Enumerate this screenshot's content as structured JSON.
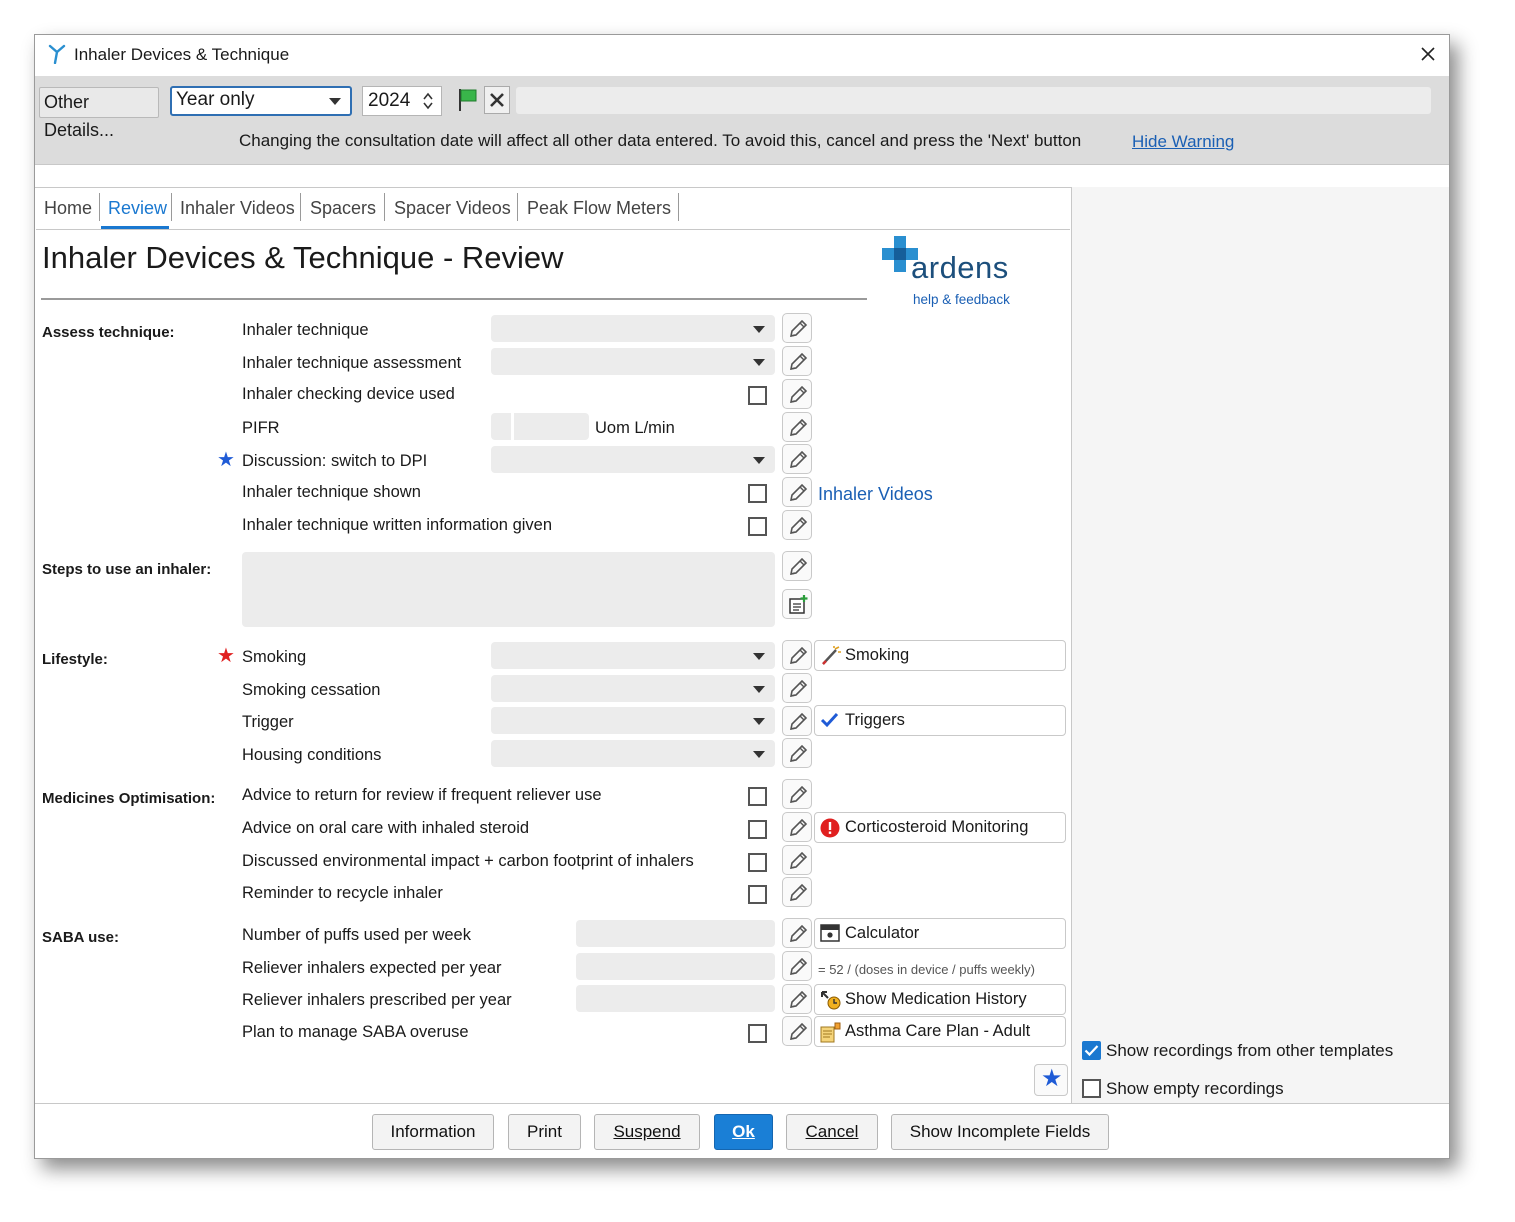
{
  "window": {
    "title": "Inhaler Devices & Technique"
  },
  "toolbar": {
    "other_details": "Other Details...",
    "date_mode": "Year only",
    "year": "2024",
    "warning": "Changing the consultation date will affect all other data entered. To avoid this, cancel and press the 'Next' button",
    "hide_warning": "Hide Warning"
  },
  "tabs": [
    "Home",
    "Review",
    "Inhaler Videos",
    "Spacers",
    "Spacer Videos",
    "Peak Flow Meters"
  ],
  "page_title": "Inhaler Devices & Technique - Review",
  "logo": {
    "text": "ardens",
    "sub": "help & feedback"
  },
  "sections": {
    "assess": "Assess technique:",
    "steps": "Steps to use an inhaler:",
    "lifestyle": "Lifestyle:",
    "medicines": "Medicines Optimisation:",
    "saba": "SABA use:"
  },
  "assess_rows": [
    "Inhaler technique",
    "Inhaler technique assessment",
    "Inhaler checking device used",
    "PIFR",
    "Discussion: switch to DPI",
    "Inhaler technique shown",
    "Inhaler technique written information given"
  ],
  "pifr_uom": "Uom L/min",
  "inhaler_videos_link": "Inhaler Videos",
  "lifestyle_rows": [
    "Smoking",
    "Smoking cessation",
    "Trigger",
    "Housing conditions"
  ],
  "medicines_rows": [
    "Advice to return for review if frequent reliever use",
    "Advice on oral care with inhaled steroid",
    "Discussed environmental impact + carbon footprint of inhalers",
    "Reminder to recycle inhaler"
  ],
  "saba_rows": [
    "Number of puffs used per week",
    "Reliever inhalers expected per year",
    "Reliever inhalers prescribed per year",
    "Plan to manage SABA overuse"
  ],
  "side_buttons": {
    "smoking": "Smoking",
    "triggers": "Triggers",
    "corticosteroid": "Corticosteroid Monitoring",
    "calculator": "Calculator",
    "formula": "= 52 / (doses in device / puffs weekly)",
    "med_history": "Show Medication History",
    "care_plan": "Asthma Care Plan - Adult"
  },
  "options": {
    "show_other": "Show recordings from other templates",
    "show_other_checked": true,
    "show_empty": "Show empty recordings",
    "show_empty_checked": false
  },
  "footer": [
    "Information",
    "Print",
    "Suspend",
    "Ok",
    "Cancel",
    "Show Incomplete Fields"
  ],
  "colors": {
    "accent": "#1a78d0",
    "link": "#1a5fb4",
    "required_star": "#e02020",
    "info_star": "#1f5bd6"
  }
}
